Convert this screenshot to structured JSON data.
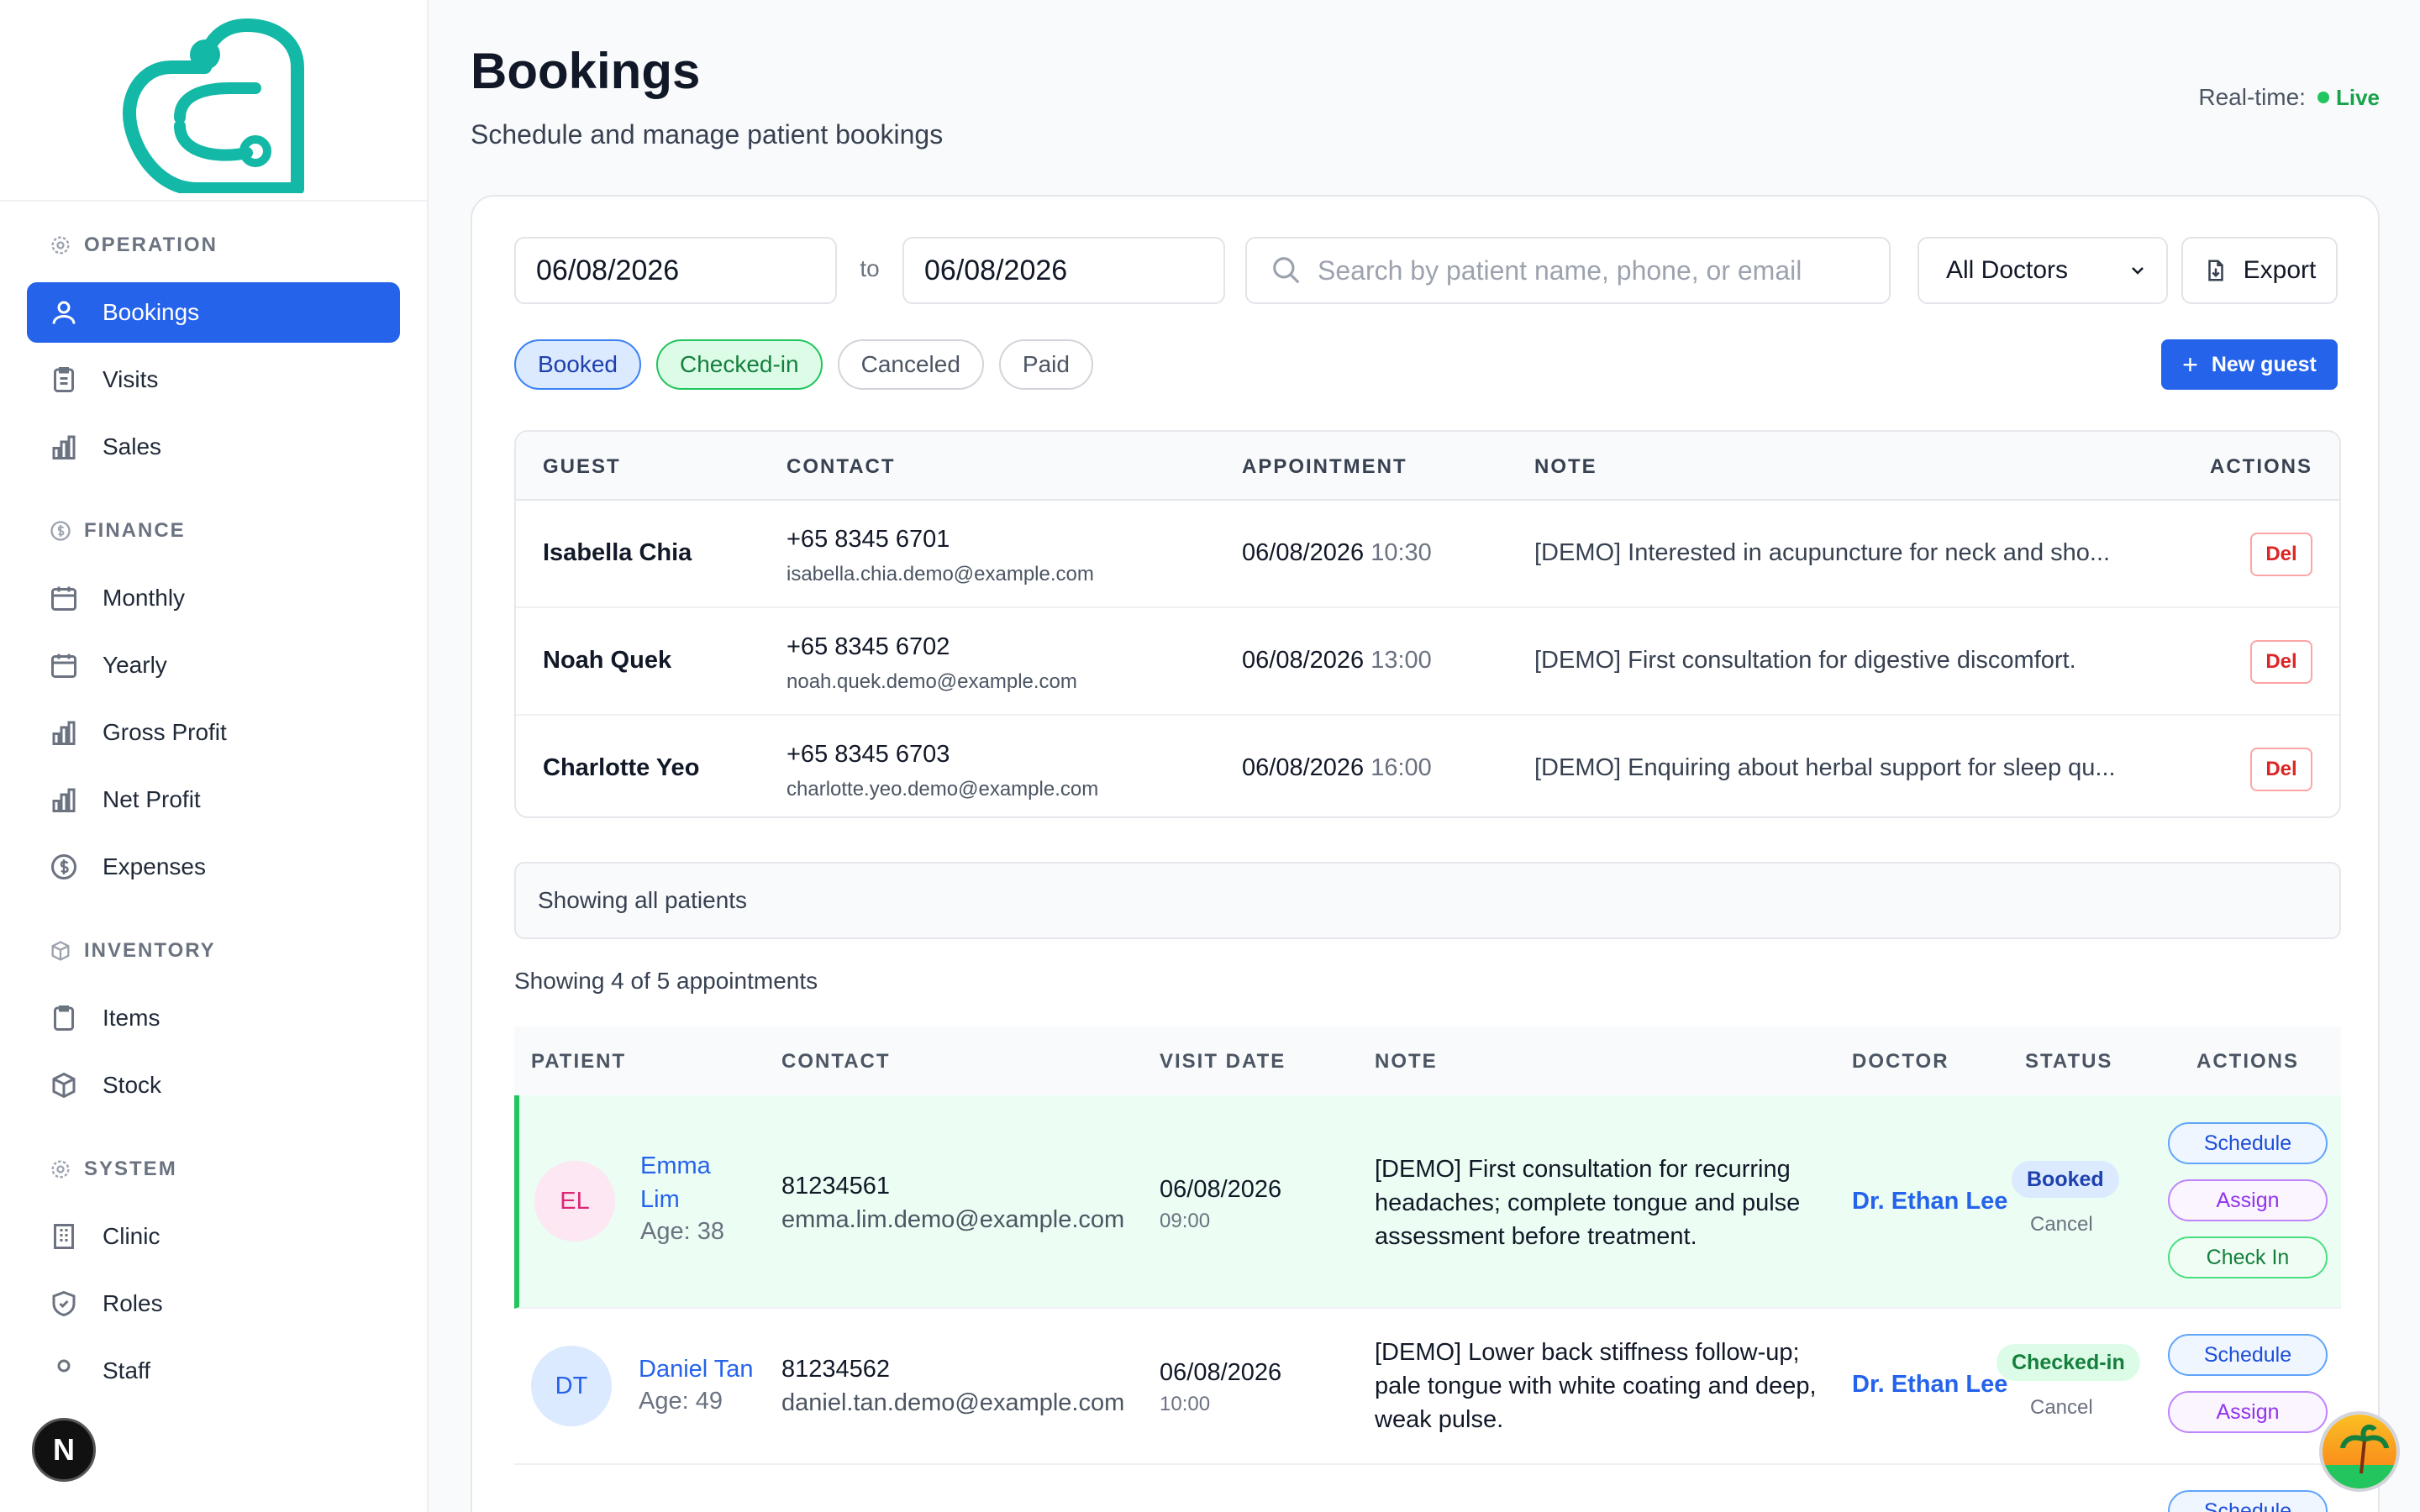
{
  "sidebar": {
    "sections": [
      {
        "title": "OPERATION",
        "items": [
          {
            "label": "Bookings",
            "active": true
          },
          {
            "label": "Visits"
          },
          {
            "label": "Sales"
          }
        ]
      },
      {
        "title": "FINANCE",
        "items": [
          {
            "label": "Monthly"
          },
          {
            "label": "Yearly"
          },
          {
            "label": "Gross Profit"
          },
          {
            "label": "Net Profit"
          },
          {
            "label": "Expenses"
          }
        ]
      },
      {
        "title": "INVENTORY",
        "items": [
          {
            "label": "Items"
          },
          {
            "label": "Stock"
          }
        ]
      },
      {
        "title": "SYSTEM",
        "items": [
          {
            "label": "Clinic"
          },
          {
            "label": "Roles"
          },
          {
            "label": "Staff"
          }
        ]
      }
    ],
    "fab_label": "N"
  },
  "header": {
    "title": "Bookings",
    "subtitle": "Schedule and manage patient bookings",
    "realtime_label": "Real-time:",
    "live_label": "Live"
  },
  "filters": {
    "date_from": "06/08/2026",
    "to_label": "to",
    "date_to": "06/08/2026",
    "search_placeholder": "Search by patient name, phone, or email",
    "doctor_select": "All Doctors",
    "export_label": "Export",
    "chips": [
      "Booked",
      "Checked-in",
      "Canceled",
      "Paid"
    ],
    "new_guest_label": "New guest"
  },
  "guest_table": {
    "columns": [
      "GUEST",
      "CONTACT",
      "APPOINTMENT",
      "NOTE",
      "ACTIONS"
    ],
    "rows": [
      {
        "name": "Isabella Chia",
        "phone": "+65 8345 6701",
        "email": "isabella.chia.demo@example.com",
        "date": "06/08/2026",
        "time": "10:30",
        "note": "[DEMO] Interested in acupuncture for neck and sho...",
        "action": "Del"
      },
      {
        "name": "Noah Quek",
        "phone": "+65 8345 6702",
        "email": "noah.quek.demo@example.com",
        "date": "06/08/2026",
        "time": "13:00",
        "note": "[DEMO] First consultation for digestive discomfort.",
        "action": "Del"
      },
      {
        "name": "Charlotte Yeo",
        "phone": "+65 8345 6703",
        "email": "charlotte.yeo.demo@example.com",
        "date": "06/08/2026",
        "time": "16:00",
        "note": "[DEMO] Enquiring about herbal support for sleep qu...",
        "action": "Del"
      }
    ]
  },
  "showing_all": "Showing all patients",
  "count_text": "Showing 4 of 5 appointments",
  "appt_table": {
    "columns": [
      "PATIENT",
      "CONTACT",
      "VISIT DATE",
      "NOTE",
      "DOCTOR",
      "STATUS",
      "ACTIONS"
    ],
    "rows": [
      {
        "initials": "EL",
        "name_line1": "Emma",
        "name_line2": "Lim",
        "age": "Age: 38",
        "phone": "81234561",
        "email": "emma.lim.demo@example.com",
        "date": "06/08/2026",
        "time": "09:00",
        "note": "[DEMO] First consultation for recurring headaches; complete tongue and pulse assessment before treatment.",
        "doctor": "Dr. Ethan Lee",
        "status": "Booked",
        "cancel": "Cancel",
        "actions": [
          "Schedule",
          "Assign",
          "Check In"
        ]
      },
      {
        "initials": "DT",
        "name_line1": "Daniel Tan",
        "age": "Age: 49",
        "phone": "81234562",
        "email": "daniel.tan.demo@example.com",
        "date": "06/08/2026",
        "time": "10:00",
        "note": "[DEMO] Lower back stiffness follow-up; pale tongue with white coating and deep, weak pulse.",
        "doctor": "Dr. Ethan Lee",
        "status": "Checked-in",
        "cancel": "Cancel",
        "actions": [
          "Schedule",
          "Assign"
        ]
      },
      {
        "actions": [
          "Schedule"
        ]
      }
    ]
  },
  "colors": {
    "accent": "#2563eb",
    "live": "#22c55e",
    "danger": "#dc2626",
    "logo": "#14b8a6"
  }
}
